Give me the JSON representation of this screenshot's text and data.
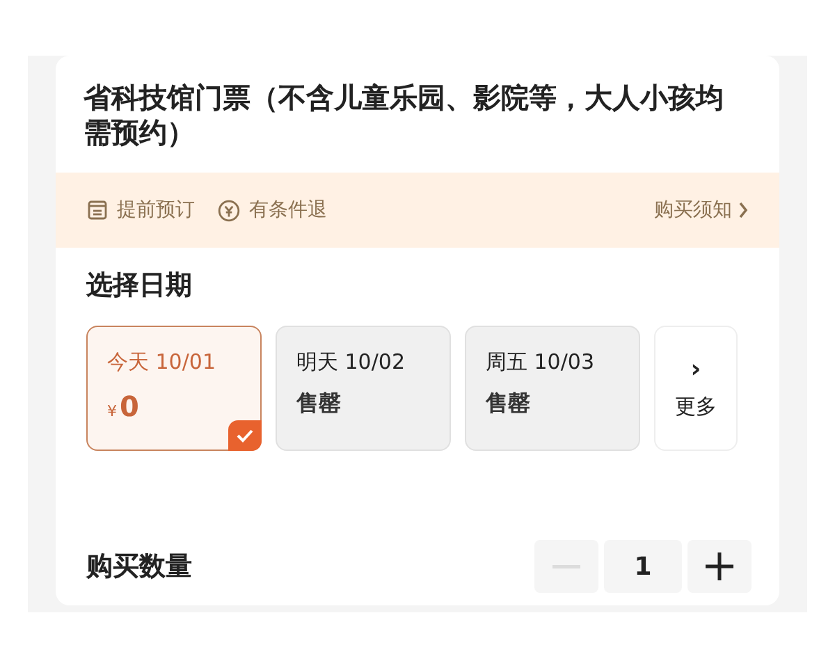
{
  "title": "省科技馆门票（不含儿童乐园、影院等，大人小孩均需预约）",
  "notices": [
    {
      "kind": "booking",
      "label": "提前预订"
    },
    {
      "kind": "refund",
      "label": "有条件退"
    }
  ],
  "notice_link": "购买须知",
  "date_section": {
    "heading": "选择日期",
    "dates": [
      {
        "kind": "price",
        "label": "今天 10/01",
        "currency": "¥",
        "price": "0",
        "selected": true
      },
      {
        "kind": "soldout",
        "label": "明天 10/02",
        "status": "售罄",
        "selected": false
      },
      {
        "kind": "soldout",
        "label": "周五 10/03",
        "status": "售罄",
        "selected": false
      }
    ],
    "more": {
      "arrow": "›",
      "label": "更多"
    }
  },
  "quantity": {
    "label": "购买数量",
    "value": "1",
    "minus_disabled": true
  }
}
